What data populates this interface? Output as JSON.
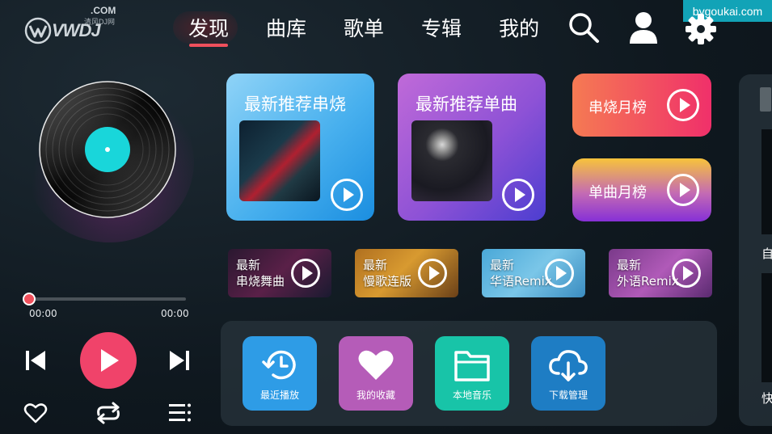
{
  "watermark": "bygoukai.com",
  "logo": {
    "main": "VWDJ",
    "com": ".COM",
    "sub": "清风DJ网"
  },
  "nav": {
    "items": [
      {
        "label": "发现",
        "active": true
      },
      {
        "label": "曲库",
        "active": false
      },
      {
        "label": "歌单",
        "active": false
      },
      {
        "label": "专辑",
        "active": false
      },
      {
        "label": "我的",
        "active": false
      }
    ],
    "icons": [
      "search-icon",
      "user-icon",
      "gear-icon"
    ]
  },
  "player": {
    "elapsed": "00:00",
    "total": "00:00",
    "progress": 0,
    "accent": "#f0505c"
  },
  "featured": {
    "mix": {
      "title": "最新推荐串烧",
      "color_from": "#8fd1f5",
      "color_to": "#1f93e0"
    },
    "single": {
      "title": "最新推荐单曲",
      "color_from": "#c06ad8",
      "color_to": "#4c3ed0"
    }
  },
  "charts": {
    "mix_month": {
      "label": "串烧月榜",
      "color_from": "#f57a53",
      "color_to": "#f0306a"
    },
    "single_month": {
      "label": "单曲月榜",
      "color_from": "#f7c33b",
      "color_to": "#8630d6"
    }
  },
  "categories": [
    {
      "line1": "最新",
      "line2": "串烧舞曲"
    },
    {
      "line1": "最新",
      "line2": "慢歌连版"
    },
    {
      "line1": "最新",
      "line2": "华语Remix"
    },
    {
      "line1": "最新",
      "line2": "外语Remix"
    }
  ],
  "shortcuts": [
    {
      "label": "最近播放",
      "icon": "history-icon",
      "color": "#2e9ce6"
    },
    {
      "label": "我的收藏",
      "icon": "heart-icon",
      "color": "#b55cb8"
    },
    {
      "label": "本地音乐",
      "icon": "folder-icon",
      "color": "#18c4a8"
    },
    {
      "label": "下载管理",
      "icon": "cloud-download-icon",
      "color": "#1e7dc4"
    }
  ],
  "right_panel": {
    "text_top": "自",
    "text_bottom": "快"
  }
}
